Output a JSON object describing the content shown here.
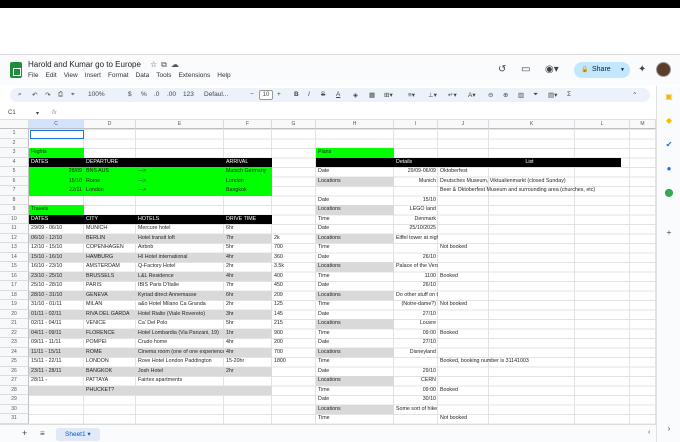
{
  "doc": {
    "title": "Harold and Kumar go to Europe"
  },
  "menu": [
    "File",
    "Edit",
    "View",
    "Insert",
    "Format",
    "Data",
    "Tools",
    "Extensions",
    "Help"
  ],
  "share_label": "Share",
  "toolbar": {
    "zoom": "100%",
    "currency": "$",
    "percent": "%",
    "dec1": ".0",
    "dec2": ".00",
    "numfmt": "123",
    "font": "Defaul...",
    "font_size": "10"
  },
  "namebox": "C1",
  "fx": "fx",
  "sheet_tab": "Sheet1",
  "columns": [
    "C",
    "D",
    "E",
    "F",
    "G",
    "H",
    "I",
    "J",
    "K",
    "L",
    "M"
  ],
  "rows": [
    "1",
    "2",
    "3",
    "4",
    "5",
    "6",
    "7",
    "8",
    "9",
    "10",
    "11",
    "12",
    "13",
    "14",
    "15",
    "16",
    "17",
    "18",
    "19",
    "20",
    "21",
    "22",
    "23",
    "24",
    "25",
    "26",
    "27",
    "28",
    "29",
    "30",
    "31",
    "32"
  ],
  "flights": {
    "label": "Flights",
    "headers": [
      "DATES",
      "DEPARTURE",
      "",
      "ARRIVAL"
    ],
    "rows": [
      [
        "28/09",
        "BNS AUS",
        "--->",
        "Munich Germany"
      ],
      [
        "15/10",
        "Rome",
        "--->",
        "London"
      ],
      [
        "22/11",
        "London",
        "--->",
        "Bangkok"
      ]
    ]
  },
  "travels": {
    "label": "Travels",
    "headers": [
      "DATES",
      "CITY",
      "HOTELS",
      "DRIVE TIME"
    ],
    "rows": [
      [
        "29/09 - 06/10",
        "MUNICH",
        "Mercure hotel",
        "6hr",
        ""
      ],
      [
        "06/10 - 12/10",
        "BERLIN",
        "Hotel transit loft",
        "7hr",
        "2k"
      ],
      [
        "12/10 - 15/10",
        "COPENHAGEN",
        "Airbnb",
        "5hr",
        "700"
      ],
      [
        "15/10 - 16/10",
        "HAMBURG",
        "HI Hotel international",
        "4hr",
        "360"
      ],
      [
        "16/10 - 23/10",
        "AMSTERDAM",
        "Q-Factory Hotel",
        "2hr",
        "3.5k"
      ],
      [
        "23/10 - 25/10",
        "BRUSSELS",
        "L&L Residence",
        "4hr",
        "400"
      ],
      [
        "25/10 - 28/10",
        "PARIS",
        "IBIS Paris D'Italie",
        "7hr",
        "450"
      ],
      [
        "28/10 - 31/10",
        "GENEVA",
        "Kyriad direct Annemasse",
        "6hr",
        "209"
      ],
      [
        "31/10 - 01/11",
        "MILAN",
        "a&o Hotel Milano Ca Granda",
        "2hr",
        "125"
      ],
      [
        "01/11 - 02/11",
        "RIVA DEL GARDA",
        "Hotel Rialto (Viale Rovereto)",
        "3hr",
        "145"
      ],
      [
        "02/11 - 04/11",
        "VENICE",
        "Ca' Del Polo",
        "5hr",
        "215"
      ],
      [
        "04/11 - 09/11",
        "FLORENCE",
        "Hotel Lombardia (Via Panzani, 19)",
        "1hr",
        "900"
      ],
      [
        "09/11 - 11/11",
        "POMPEI",
        "Crudo home",
        "4hr",
        "200"
      ],
      [
        "11/11 - 15/11",
        "ROME",
        "Cinema room (one of one experience)",
        "4hr",
        "700"
      ],
      [
        "15/11 - 22/11",
        "LONDON",
        "Rove Hotel London Paddington",
        "15-20hr",
        "1800"
      ],
      [
        "23/11 - 28/11",
        "BANGKOK",
        "Josh Hotel",
        "2hr",
        ""
      ],
      [
        "28/11 -",
        "PATTAYA",
        "Fairtex apartments",
        "",
        ""
      ],
      [
        "",
        "PHUCKET?",
        "",
        "",
        ""
      ]
    ]
  },
  "plans": {
    "label": "Plans",
    "headers": [
      "",
      "Details",
      "List"
    ],
    "rows": [
      [
        "Date",
        "29/09-06/09",
        "Oktoberfest"
      ],
      [
        "Locations",
        "Munich",
        "Deutsches Museum, Viktualienmarkt (closed Sunday)"
      ],
      [
        "",
        "",
        "Beer & Oktoberfest Museum and surrounding area (churches, etc)"
      ],
      [
        "Date",
        "15/10",
        ""
      ],
      [
        "Locations",
        "LEGO land",
        ""
      ],
      [
        "Time",
        "Denmark",
        ""
      ],
      [
        "Date",
        "25/10/2025",
        ""
      ],
      [
        "Locations",
        "Eiffel tower at night",
        ""
      ],
      [
        "Time",
        "",
        "Not booked"
      ],
      [
        "Date",
        "26/10",
        ""
      ],
      [
        "Locations",
        "Palace of the Versailles",
        ""
      ],
      [
        "Time",
        "1100",
        "Booked"
      ],
      [
        "Date",
        "26/10",
        ""
      ],
      [
        "Locations",
        "Do other stuff on the",
        ""
      ],
      [
        "Time",
        "(Notre-dame?)",
        "Not booked"
      ],
      [
        "Date",
        "27/10",
        ""
      ],
      [
        "Locations",
        "Louvre",
        ""
      ],
      [
        "Time",
        "09:00",
        "Booked"
      ],
      [
        "Date",
        "27/10",
        ""
      ],
      [
        "Locations",
        "Disneyland",
        ""
      ],
      [
        "Time",
        "",
        "Booked, booking number is 31141003"
      ],
      [
        "Date",
        "29/10",
        ""
      ],
      [
        "Locations",
        "CERN",
        ""
      ],
      [
        "Time",
        "09:00",
        "Booked"
      ],
      [
        "Date",
        "30/10",
        ""
      ],
      [
        "Locations",
        "Some sort of hike",
        ""
      ],
      [
        "Time",
        "",
        "Not booked"
      ]
    ]
  }
}
